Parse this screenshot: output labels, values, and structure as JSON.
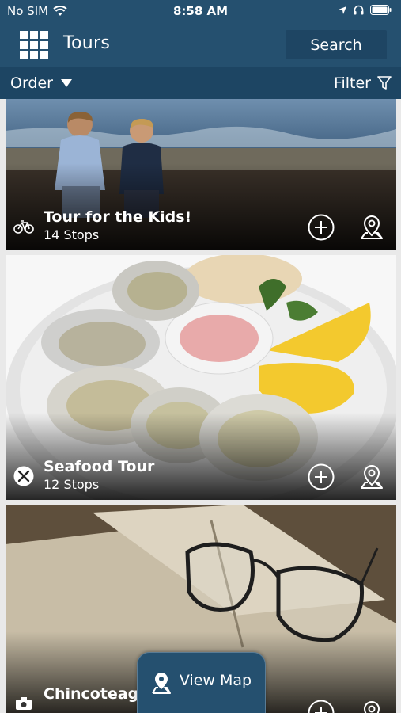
{
  "status_bar": {
    "carrier": "No SIM",
    "time": "8:58 AM",
    "icons": [
      "wifi-icon",
      "location-arrow-icon",
      "headphones-icon",
      "battery-icon"
    ]
  },
  "nav": {
    "menu_icon": "grid-menu-icon",
    "title": "Tours",
    "search_label": "Search"
  },
  "toolbar": {
    "order_label": "Order",
    "filter_label": "Filter"
  },
  "tours": [
    {
      "title": "Tour for the Kids!",
      "stops": "14 Stops",
      "type_icon": "bicycle-icon",
      "image": "two boys looking at the ocean on a beach"
    },
    {
      "title": "Seafood Tour",
      "stops": "12 Stops",
      "type_icon": "fork-knife-icon",
      "image": "plate of oysters with lemon, bread and sauce"
    },
    {
      "title": "Chincoteagu",
      "stops": "",
      "type_icon": "camera-icon",
      "image": "old map book with eyeglasses"
    }
  ],
  "view_map": {
    "label": "View Map"
  },
  "colors": {
    "header": "#25506f",
    "subbar": "#1d4563",
    "background": "#e9e9e9"
  }
}
